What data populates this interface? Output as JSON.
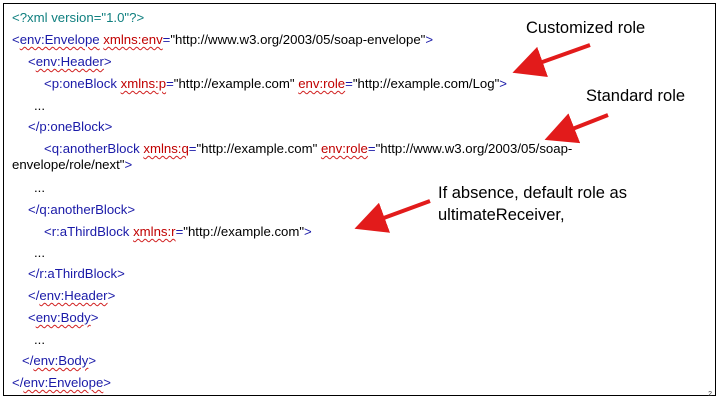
{
  "code": {
    "l1": "<?xml version=\"1.0\"?>",
    "l2": {
      "open": "<",
      "tag": "env:Envelope",
      "sp": " ",
      "attr": "xmlns:env",
      "eq": "=",
      "val": "\"http://www.w3.org/2003/05/soap-envelope\"",
      "close": ">"
    },
    "l3": {
      "open": "<",
      "tag": "env:Header",
      "close": ">"
    },
    "l4": {
      "open": "<",
      "tag": "p:oneBlock",
      "sp": " ",
      "attr1": "xmlns:p",
      "eq1": "=",
      "val1": "\"http://example.com\"",
      "sp2": " ",
      "attr2": "env:role",
      "eq2": "=",
      "val2": "\"http://example.com/Log\"",
      "close": ">"
    },
    "l5": "...",
    "l6": {
      "open": "</",
      "tag": "p:oneBlock",
      "close": ">"
    },
    "l7": {
      "open": "<",
      "tag": "q:anotherBlock",
      "sp": " ",
      "attr1": "xmlns:q",
      "eq1": "=",
      "val1": "\"http://example.com\"",
      "sp2": " ",
      "attr2": "env:role",
      "eq2": "=",
      "val2": "\"http://www.w3.org/2003/05/soap-"
    },
    "l8": {
      "cont": "envelope/role/next\"",
      "close": ">"
    },
    "l9": "...",
    "l10": {
      "open": "</",
      "tag": "q:anotherBlock",
      "close": ">"
    },
    "l11": {
      "open": "<",
      "tag": "r:aThirdBlock",
      "sp": " ",
      "attr": "xmlns:r",
      "eq": "=",
      "val": "\"http://example.com\"",
      "close": ">"
    },
    "l12": "...",
    "l13": {
      "open": "</",
      "tag": "r:aThirdBlock",
      "close": ">"
    },
    "l14": {
      "open": "</",
      "tag": "env:Header",
      "close": ">"
    },
    "l15": {
      "open": "<",
      "tag": "env:Body",
      "close": ">"
    },
    "l16": "...",
    "l17": {
      "open": "</",
      "tag": "env:Body",
      "close": ">"
    },
    "l18": {
      "open": "</",
      "tag": "env:Envelope",
      "close": ">"
    }
  },
  "annotations": {
    "customized": "Customized role",
    "standard": "Standard role",
    "absence_line1": "If absence, default role as",
    "absence_line2": "ultimateReceiver,"
  },
  "page_number": "2",
  "colors": {
    "arrow": "#e21b1b",
    "tag": "#1a1aa8",
    "declaration": "#0f7f7f",
    "squiggle": "#d12020"
  }
}
